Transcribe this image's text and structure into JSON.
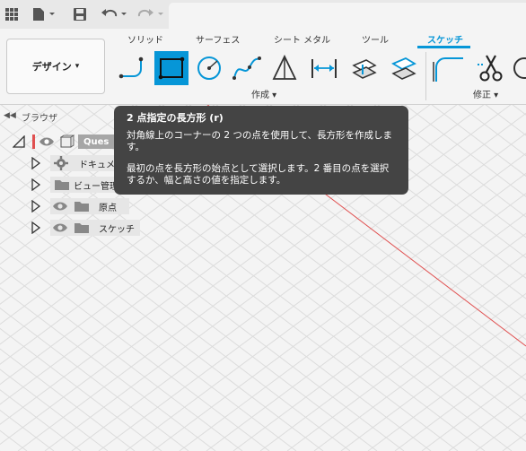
{
  "toolbar": {
    "icons": [
      "grid-menu-icon",
      "file-icon",
      "save-icon",
      "undo-icon",
      "redo-icon"
    ]
  },
  "workspace": {
    "label": "デザイン",
    "caret": "▾"
  },
  "tabs": [
    {
      "label": "ソリッド",
      "active": false
    },
    {
      "label": "サーフェス",
      "active": false
    },
    {
      "label": "シート メタル",
      "active": false
    },
    {
      "label": "ツール",
      "active": false
    },
    {
      "label": "スケッチ",
      "active": true
    }
  ],
  "groups": {
    "create_label": "作成 ▾",
    "modify_label": "修正 ▾"
  },
  "tools": [
    "line-icon",
    "rectangle-icon",
    "circle-icon",
    "spline-icon",
    "triangle-icon",
    "dimension-icon",
    "project-icon",
    "offset-icon",
    "fillet-icon",
    "trim-icon",
    "circle-partial-icon"
  ],
  "browser": {
    "title": "ブラウザ",
    "root": "Ques",
    "items": [
      {
        "label": "ドキュメン",
        "icon": "gear-icon"
      },
      {
        "label": "ビュー管理",
        "icon": "folder-icon"
      },
      {
        "label": "原点",
        "icon": "folder-icon"
      },
      {
        "label": "スケッチ",
        "icon": "folder-icon"
      }
    ]
  },
  "tooltip": {
    "title": "2 点指定の長方形 (r)",
    "para1": "対角線上のコーナーの 2 つの点を使用して、長方形を作成します。",
    "para2": "最初の点を長方形の始点として選択します。2 番目の点を選択するか、幅と高さの値を指定します。"
  },
  "colors": {
    "accent": "#0696d7",
    "tooltip_bg": "#444444",
    "axis_red": "#e05050",
    "grid": "#d9d9d9"
  }
}
